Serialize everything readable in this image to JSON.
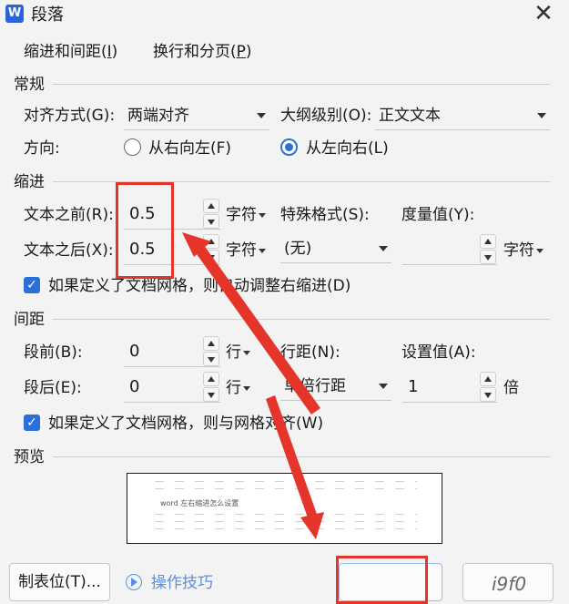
{
  "title_bar": {
    "app_icon": "W",
    "title": "段落",
    "close_glyph": "✕"
  },
  "tabs": [
    {
      "label": "缩进和间距(",
      "key": "I",
      "tail": ")"
    },
    {
      "label": "换行和分页(",
      "key": "P",
      "tail": ")"
    }
  ],
  "general": {
    "section": "常规",
    "align_label": "对齐方式(G):",
    "align_value": "两端对齐",
    "outline_label": "大纲级别(O):",
    "outline_value": "正文文本",
    "direction_label": "方向:",
    "rtl_label": "从右向左(F)",
    "ltr_label": "从左向右(L)",
    "selected_direction": "ltr"
  },
  "indent": {
    "section": "缩进",
    "before_label": "文本之前(R):",
    "before_value": "0.5",
    "before_unit": "字符",
    "after_label": "文本之后(X):",
    "after_value": "0.5",
    "after_unit": "字符",
    "special_label": "特殊格式(S):",
    "special_value": "(无)",
    "measure_label": "度量值(Y):",
    "measure_value": "",
    "measure_unit": "字符",
    "grid_checkbox_label": "如果定义了文档网格，则自动调整右缩进(D)",
    "grid_checked": true
  },
  "spacing": {
    "section": "间距",
    "before_label": "段前(B):",
    "before_value": "0",
    "before_unit": "行",
    "after_label": "段后(E):",
    "after_value": "0",
    "after_unit": "行",
    "line_label": "行距(N):",
    "line_value": "单倍行距",
    "set_label": "设置值(A):",
    "set_value": "1",
    "set_unit": "倍",
    "grid_checkbox_label": "如果定义了文档网格，则与网格对齐(W)",
    "grid_checked": true
  },
  "preview": {
    "section": "预览",
    "sample_text": "word 左右缩进怎么设置"
  },
  "footer": {
    "tabs_button": "制表位(T)...",
    "tips_button": "操作技巧",
    "watermark": "i9f0"
  },
  "annotation_color": "#e5342a",
  "accent_color": "#2b6fd8"
}
